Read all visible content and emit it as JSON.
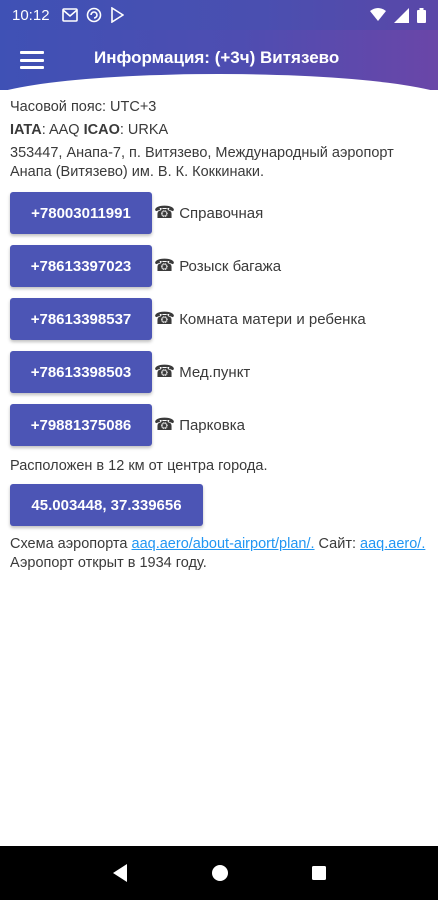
{
  "status": {
    "time": "10:12"
  },
  "app_bar": {
    "title": "Информация: (+3ч) Витязево",
    "menu_icon": "hamburger-menu-icon"
  },
  "info": {
    "timezone": "Часовой пояс: UTC+3",
    "iata_label": "IATA",
    "iata_value": ": AAQ ",
    "icao_label": "ICAO",
    "icao_value": ": URKA",
    "address": "353447, Анапа-7, п. Витязево, Международный аэропорт Анапа (Витязево) им. В. К. Коккинаки."
  },
  "phones": [
    {
      "number": "+78003011991",
      "label": "Справочная"
    },
    {
      "number": "+78613397023",
      "label": "Розыск багажа"
    },
    {
      "number": "+78613398537",
      "label": "Комната матери и ребенка"
    },
    {
      "number": "+78613398503",
      "label": "Мед.пункт"
    },
    {
      "number": "+79881375086",
      "label": "Парковка"
    }
  ],
  "phone_glyph": "☎",
  "location": {
    "distance": "Расположен в 12 км от центра города.",
    "coordinates": "45.003448, 37.339656"
  },
  "scheme": {
    "prefix": "Схема аэропорта ",
    "plan_link": "aaq.aero/about-airport/plan/.",
    "site_label": " Сайт: ",
    "site_link": "aaq.aero/."
  },
  "opened": "Аэропорт открыт в 1934 году."
}
